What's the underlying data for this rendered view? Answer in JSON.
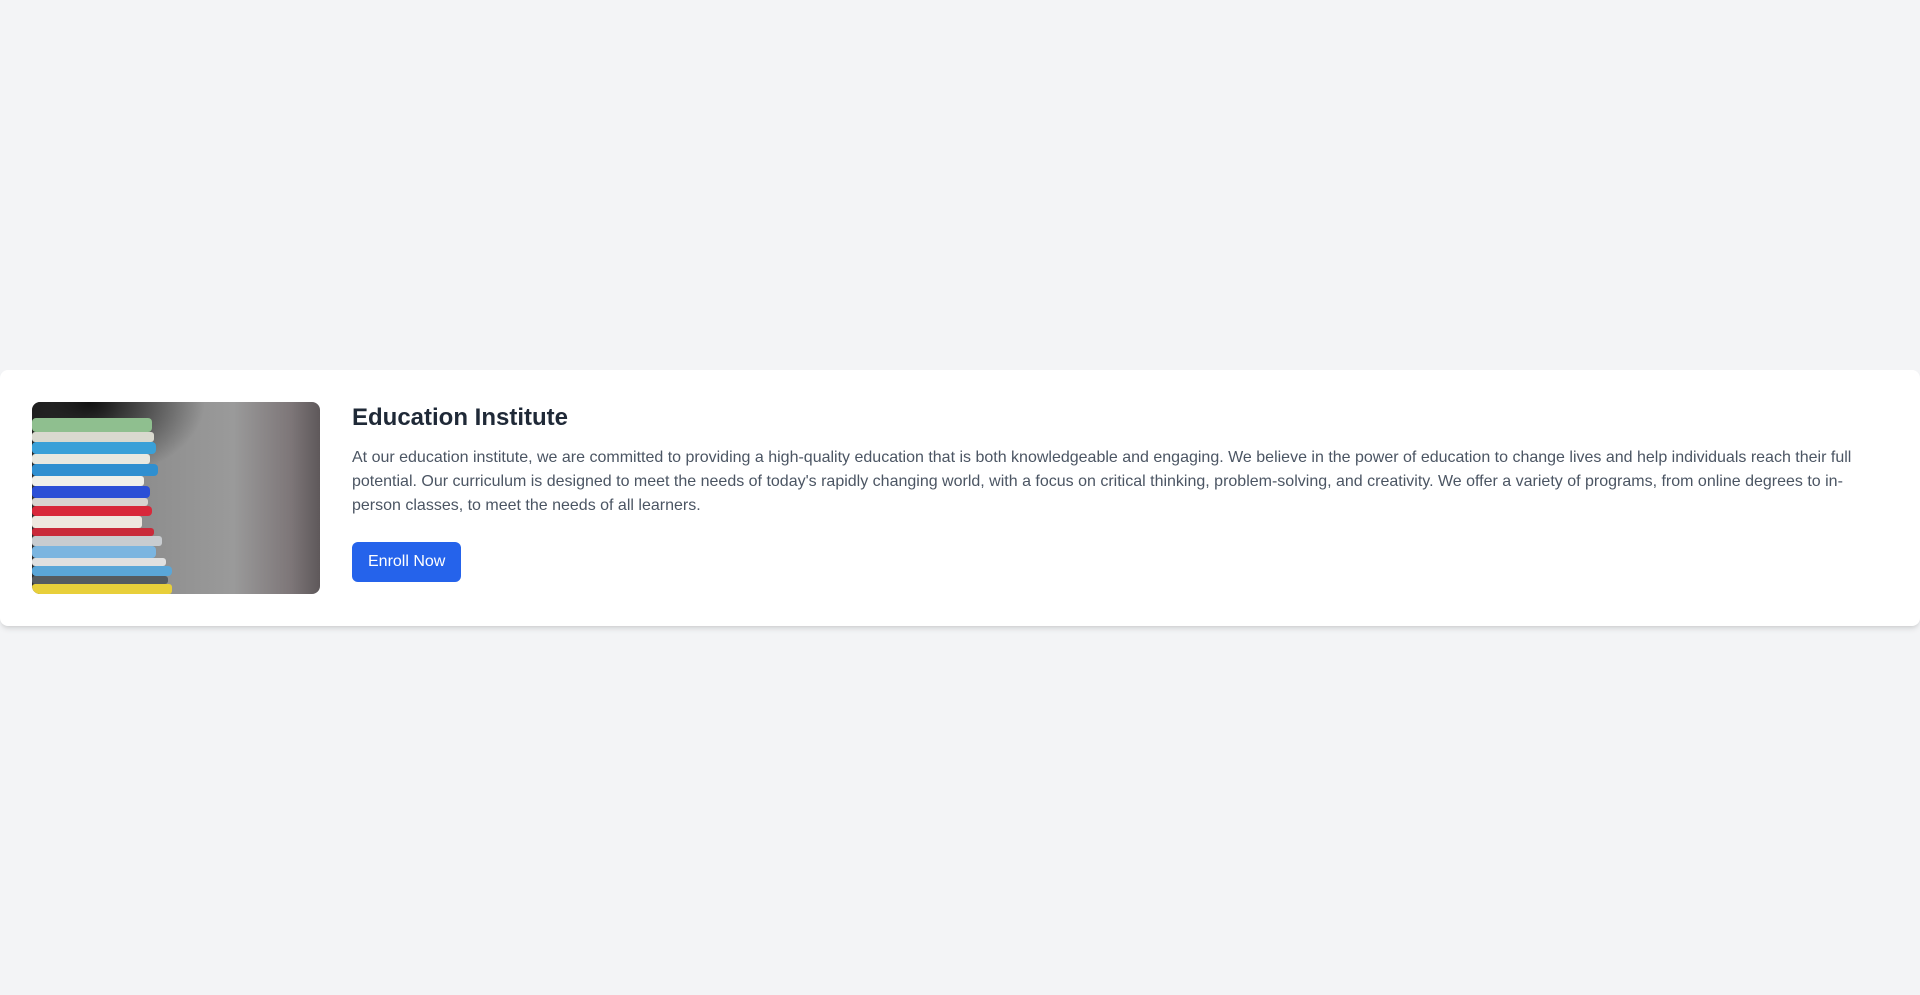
{
  "card": {
    "image": {
      "icon": "stacked-books-photo",
      "alt": "Stack of colorful books"
    },
    "title": "Education Institute",
    "description": "At our education institute, we are committed to providing a high-quality education that is both knowledgeable and engaging. We believe in the power of education to change lives and help individuals reach their full potential. Our curriculum is designed to meet the needs of today's rapidly changing world, with a focus on critical thinking, problem-solving, and creativity. We offer a variety of programs, from online degrees to in-person classes, to meet the needs of all learners.",
    "button_label": "Enroll Now"
  },
  "colors": {
    "page_bg": "#f3f4f6",
    "card_bg": "#ffffff",
    "title": "#1f2937",
    "text": "#4b5563",
    "accent": "#2563eb"
  }
}
